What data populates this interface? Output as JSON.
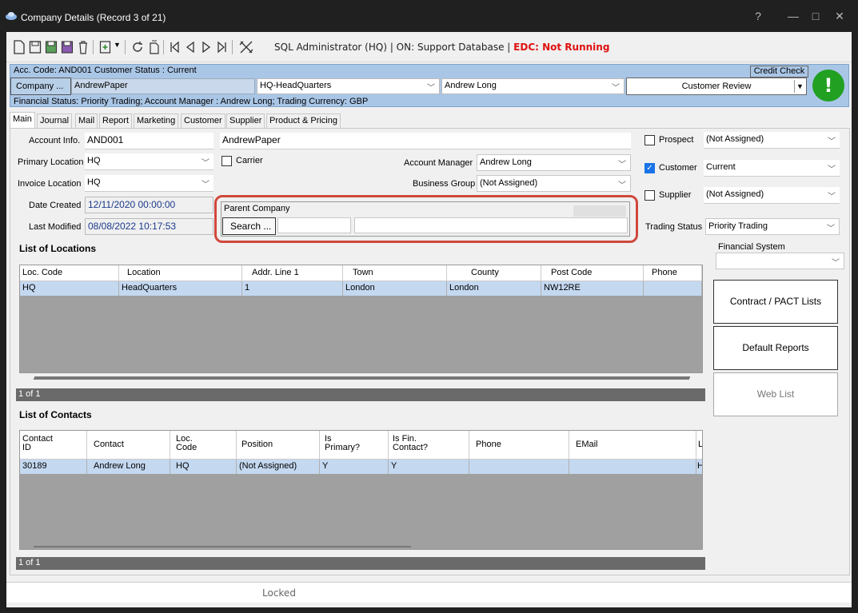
{
  "window": {
    "title": "Company Details  (Record 3 of 21)",
    "controls": [
      "?",
      "—",
      "□",
      "✕"
    ]
  },
  "toolbar": {
    "status_text": "SQL Administrator (HQ) | ON: Support Database | ",
    "edc_text": "EDC: Not Running"
  },
  "header": {
    "line1": "Acc. Code: AND001  Customer Status : Current",
    "credit_check": "Credit Check",
    "company_button": "Company ...",
    "company_name": "AndrewPaper",
    "location": "HQ-HeadQuarters",
    "manager": "Andrew Long",
    "review": "Customer Review",
    "alert_symbol": "!",
    "line3": "Financial Status: Priority Trading;  Account Manager : Andrew Long; Trading Currency: GBP"
  },
  "tabs": [
    "Main",
    "Journal",
    "Mail",
    "Report",
    "Marketing",
    "Customer",
    "Supplier",
    "Product & Pricing"
  ],
  "form": {
    "account_info_label": "Account Info.",
    "account_code": "AND001",
    "account_name": "AndrewPaper",
    "primary_location_label": "Primary Location",
    "primary_location": "HQ",
    "invoice_location_label": "Invoice Location",
    "invoice_location": "HQ",
    "carrier_label": "Carrier",
    "account_manager_label": "Account Manager",
    "account_manager": "Andrew Long",
    "business_group_label": "Business Group",
    "business_group": "(Not Assigned)",
    "date_created_label": "Date Created",
    "date_created": "12/11/2020 00:00:00",
    "last_modified_label": "Last Modified",
    "last_modified": "08/08/2022 10:17:53",
    "parent_company_label": "Parent Company",
    "search_button": "Search ...",
    "prospect_label": "Prospect",
    "prospect_value": "(Not Assigned)",
    "customer_label": "Customer",
    "customer_value": "Current",
    "supplier_label": "Supplier",
    "supplier_value": "(Not Assigned)",
    "trading_status_label": "Trading Status",
    "trading_status": "Priority Trading",
    "financial_system_label": "Financial System"
  },
  "locations": {
    "title": "List of Locations",
    "columns": [
      "Loc. Code",
      "Location",
      "Addr. Line 1",
      "Town",
      "County",
      "Post Code",
      "Phone"
    ],
    "rows": [
      [
        "HQ",
        "HeadQuarters",
        "1",
        "London",
        "London",
        "NW12RE",
        ""
      ]
    ],
    "pager": "1 of 1"
  },
  "contacts": {
    "title": "List of Contacts",
    "columns": [
      "Contact\nID",
      "Contact",
      "Loc.\nCode",
      "Position",
      "Is\nPrimary?",
      "Is Fin.\nContact?",
      "Phone",
      "EMail",
      "L"
    ],
    "rows": [
      [
        "30189",
        "Andrew Long",
        "HQ",
        "(Not Assigned)",
        "Y",
        "Y",
        "",
        "",
        "H"
      ]
    ],
    "pager": "1 of 1"
  },
  "side_buttons": {
    "contract": "Contract / PACT Lists",
    "reports": "Default Reports",
    "web": "Web List"
  },
  "status_bar": "Locked"
}
